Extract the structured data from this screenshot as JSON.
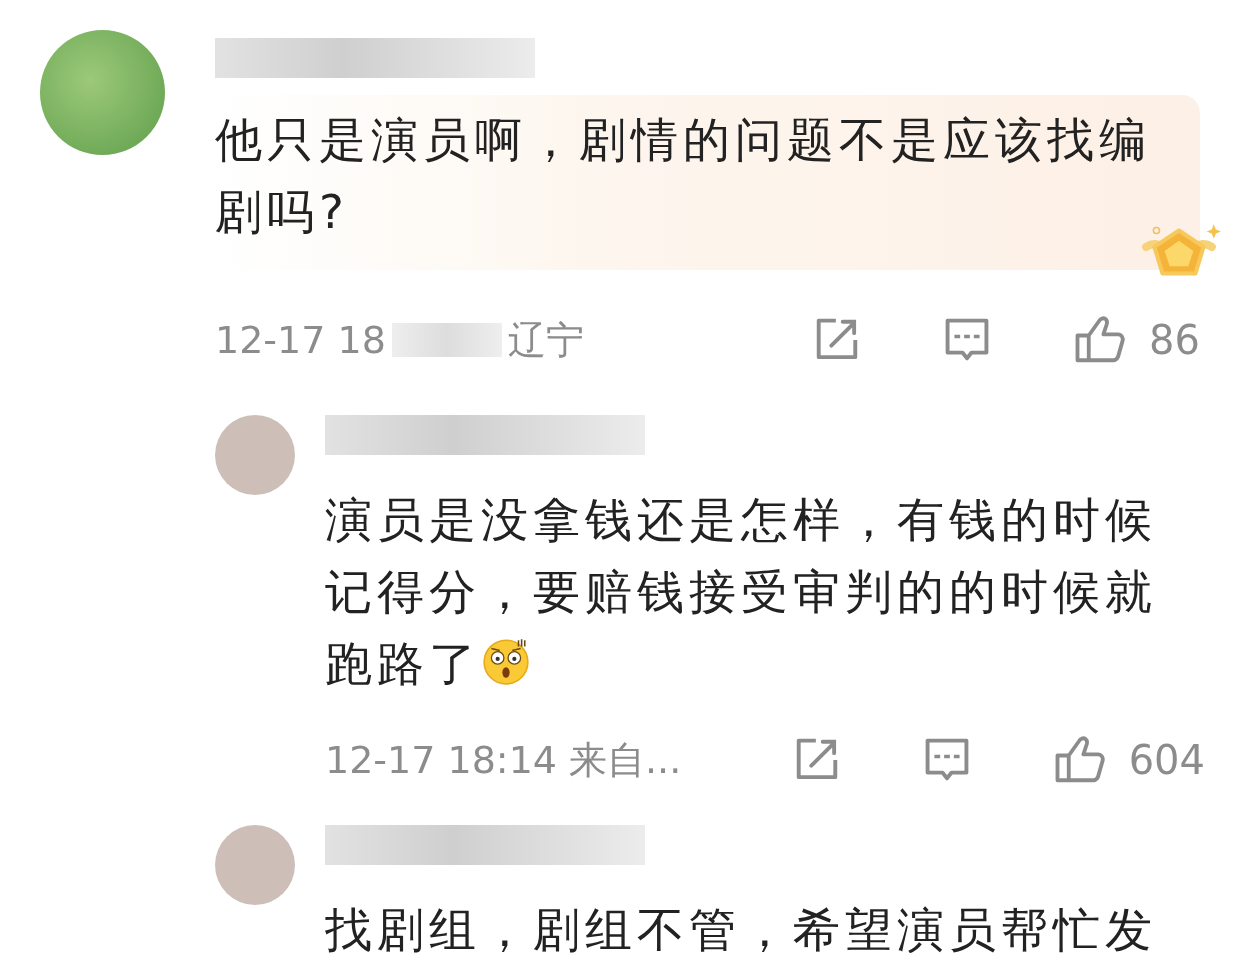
{
  "comments": [
    {
      "highlighted": true,
      "badge": true,
      "text": "他只是演员啊，剧情的问题不是应该找编剧吗?",
      "meta": {
        "time": "12-17 18",
        "redacted": true,
        "location": "辽宁",
        "likes": "86"
      },
      "children": [
        {
          "text": "演员是没拿钱还是怎样，有钱的时候记得分，要赔钱接受审判的的时候就跑路了",
          "emoji": true,
          "meta": {
            "time": "12-17 18:14",
            "location": "来自...",
            "likes": "604"
          }
        },
        {
          "text": "找剧组，剧组不管，希望演员帮忙发"
        }
      ]
    }
  ]
}
